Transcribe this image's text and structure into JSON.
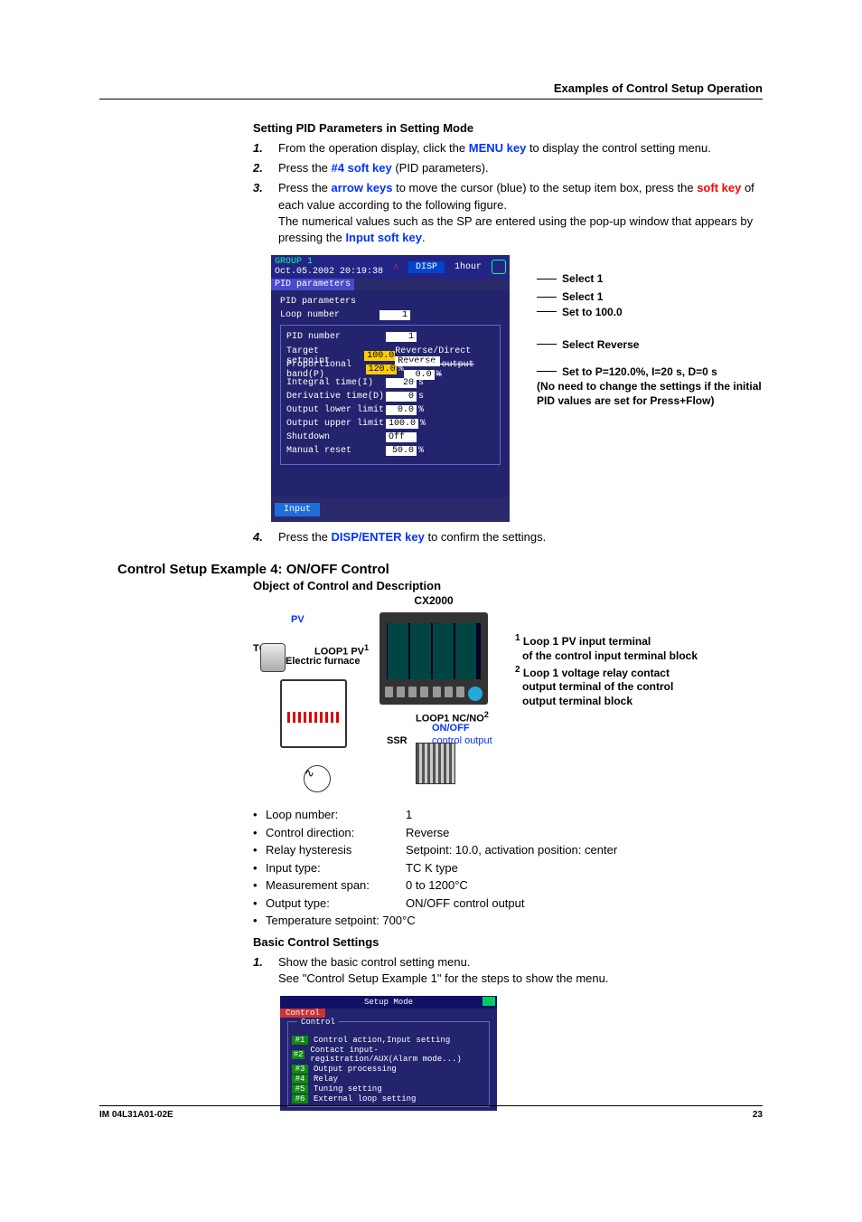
{
  "header": {
    "title": "Examples of Control Setup Operation"
  },
  "section1": {
    "heading": "Setting PID Parameters in Setting Mode",
    "step1_a": "From the operation display, click the ",
    "step1_kw": "MENU key",
    "step1_b": " to display the control setting menu.",
    "step2_a": "Press the ",
    "step2_kw": "#4 soft key",
    "step2_b": " (PID parameters).",
    "step3_a": "Press the ",
    "step3_kw1": "arrow keys",
    "step3_b": " to move the cursor (blue) to the setup item box, press the ",
    "step3_kw2": "soft key",
    "step3_c": " of each value according to the following figure.",
    "step3_note_a": "The numerical values such as the SP are entered using the pop-up window that appears by pressing the ",
    "step3_note_kw": "Input soft key",
    "step3_note_b": ".",
    "step4_a": "Press the ",
    "step4_kw": "DISP/ENTER key",
    "step4_b": " to confirm the settings."
  },
  "shot1": {
    "group": "GROUP 1",
    "ts": "Oct.05.2002 20:19:38",
    "disp": "DISP",
    "range": "1hour",
    "tab": "PID parameters",
    "lbl_pid": "PID parameters",
    "lbl_loop": "Loop number",
    "loop_val": "1",
    "lbl_pidnum": "PID number",
    "pidnum_val": "1",
    "rows": {
      "tsp": {
        "label": "Target setpoint",
        "val": "100.0"
      },
      "pb": {
        "label": "Proportional band(P)",
        "val": "120.0",
        "unit": "%"
      },
      "it": {
        "label": "Integral time(I)",
        "val": "20",
        "unit": "s"
      },
      "dt": {
        "label": "Derivative time(D)",
        "val": "0",
        "unit": "s"
      },
      "oll": {
        "label": "Output lower limit",
        "val": "0.0",
        "unit": "%"
      },
      "oul": {
        "label": "Output upper limit",
        "val": "100.0",
        "unit": "%"
      },
      "sd": {
        "label": "Shutdown",
        "val": "Off"
      },
      "mr": {
        "label": "Manual reset",
        "val": "50.0",
        "unit": "%"
      }
    },
    "revdir_lbl": "Reverse/Direct",
    "revdir_val": "Reverse",
    "preset_lbl": "Preset output",
    "preset_val": "0.0",
    "preset_unit": "%",
    "input_btn": "Input",
    "callouts": {
      "c1": "Select 1",
      "c2": "Select 1",
      "c3": "Set to 100.0",
      "c4": "Select Reverse",
      "c5a": "Set to P=120.0%, I=20 s, D=0 s",
      "c5b": "(No need to change the settings if the initial PID values are set for Press+Flow)"
    }
  },
  "section2": {
    "heading": "Control Setup Example 4: ON/OFF Control",
    "sub": "Object of Control and Description",
    "cxtitle": "CX2000",
    "pv": "PV",
    "tc": "TC",
    "loop1pv": "LOOP1 PV",
    "sup1": "1",
    "ef": "Electric furnace",
    "loop1ncno": "LOOP1 NC/NO",
    "sup2": "2",
    "onoff": "ON/OFF",
    "ssr": "SSR",
    "ctrlout": "control output",
    "right1a": "Loop 1 PV input terminal",
    "right1b": "of the control input terminal block",
    "right2a": "Loop 1 voltage relay contact",
    "right2b": "output terminal of the control",
    "right2c": "output terminal block",
    "bullets": {
      "b1": {
        "k": "Loop number:",
        "v": "1"
      },
      "b2": {
        "k": "Control direction:",
        "v": "Reverse"
      },
      "b3": {
        "k": "Relay hysteresis",
        "v": "Setpoint: 10.0, activation position: center"
      },
      "b4": {
        "k": "Input type:",
        "v": "TC K type"
      },
      "b5": {
        "k": "Measurement span:",
        "v": "0 to 1200°C"
      },
      "b6": {
        "k": "Output type:",
        "v": "ON/OFF control output"
      },
      "b7": {
        "k": "Temperature setpoint: 700°C",
        "v": ""
      }
    },
    "basic_heading": "Basic Control Settings",
    "bstep1a": "Show the basic control setting menu.",
    "bstep1b": "See \"Control Setup Example 1\" for the steps to show the menu."
  },
  "shot2": {
    "title": "Setup Mode",
    "tab": "Control",
    "frame": "Control",
    "rows": {
      "r1": {
        "n": "#1",
        "t": "Control action,Input setting"
      },
      "r2": {
        "n": "#2",
        "t": "Contact input-registration/AUX(Alarm mode...)"
      },
      "r3": {
        "n": "#3",
        "t": "Output processing"
      },
      "r4": {
        "n": "#4",
        "t": "Relay"
      },
      "r5": {
        "n": "#5",
        "t": "Tuning setting"
      },
      "r6": {
        "n": "#6",
        "t": "External loop setting"
      }
    }
  },
  "footer": {
    "left": "IM 04L31A01-02E",
    "right": "23"
  }
}
